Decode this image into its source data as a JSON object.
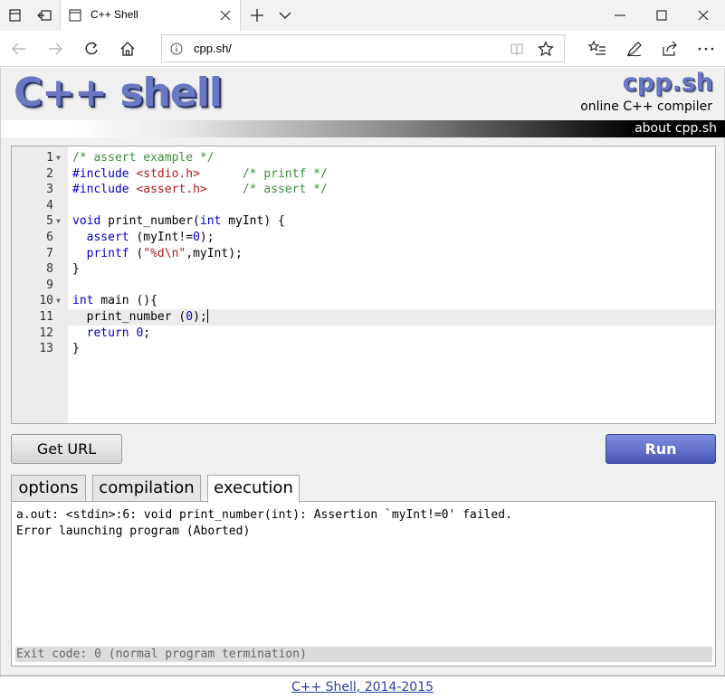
{
  "browser": {
    "tab_title": "C++ Shell",
    "address": "cpp.sh/"
  },
  "header": {
    "logo_big": "C++ shell",
    "logo_small": "cpp.sh",
    "tagline": "online C++ compiler",
    "about_link": "about cpp.sh"
  },
  "editor": {
    "lines": [
      {
        "n": "1",
        "fold": true
      },
      {
        "n": "2",
        "fold": false
      },
      {
        "n": "3",
        "fold": false
      },
      {
        "n": "4",
        "fold": false
      },
      {
        "n": "5",
        "fold": true
      },
      {
        "n": "6",
        "fold": false
      },
      {
        "n": "7",
        "fold": false
      },
      {
        "n": "8",
        "fold": false
      },
      {
        "n": "9",
        "fold": false
      },
      {
        "n": "10",
        "fold": true
      },
      {
        "n": "11",
        "fold": false
      },
      {
        "n": "12",
        "fold": false
      },
      {
        "n": "13",
        "fold": false
      }
    ],
    "code": [
      [
        {
          "t": "/* assert example */",
          "c": "com"
        }
      ],
      [
        {
          "t": "#include ",
          "c": "pp"
        },
        {
          "t": "<stdio.h>",
          "c": "str"
        },
        {
          "t": "      ",
          "c": ""
        },
        {
          "t": "/* printf */",
          "c": "com"
        }
      ],
      [
        {
          "t": "#include ",
          "c": "pp"
        },
        {
          "t": "<assert.h>",
          "c": "str"
        },
        {
          "t": "     ",
          "c": ""
        },
        {
          "t": "/* assert */",
          "c": "com"
        }
      ],
      [],
      [
        {
          "t": "void",
          "c": "kw"
        },
        {
          "t": " print_number(",
          "c": ""
        },
        {
          "t": "int",
          "c": "kw"
        },
        {
          "t": " myInt) {",
          "c": ""
        }
      ],
      [
        {
          "t": "  assert",
          "c": "kw"
        },
        {
          "t": " (myInt!=",
          "c": ""
        },
        {
          "t": "0",
          "c": "num"
        },
        {
          "t": ");",
          "c": ""
        }
      ],
      [
        {
          "t": "  printf",
          "c": "kw"
        },
        {
          "t": " (",
          "c": ""
        },
        {
          "t": "\"%d\\n\"",
          "c": "str"
        },
        {
          "t": ",myInt);",
          "c": ""
        }
      ],
      [
        {
          "t": "}",
          "c": ""
        }
      ],
      [],
      [
        {
          "t": "int",
          "c": "kw"
        },
        {
          "t": " main (){",
          "c": ""
        }
      ],
      [
        {
          "t": "  print_number (",
          "c": ""
        },
        {
          "t": "0",
          "c": "num"
        },
        {
          "t": ");",
          "c": ""
        }
      ],
      [
        {
          "t": "  return",
          "c": "kw"
        },
        {
          "t": " ",
          "c": ""
        },
        {
          "t": "0",
          "c": "num"
        },
        {
          "t": ";",
          "c": ""
        }
      ],
      [
        {
          "t": "}",
          "c": ""
        }
      ]
    ],
    "active_line": 11
  },
  "buttons": {
    "get_url": "Get URL",
    "run": "Run"
  },
  "tabs": [
    "options",
    "compilation",
    "execution"
  ],
  "active_tab": "execution",
  "output": {
    "lines": [
      "a.out: <stdin>:6: void print_number(int): Assertion `myInt!=0' failed.",
      "Error launching program (Aborted)"
    ],
    "exit": "Exit code: 0 (normal program termination)"
  },
  "footer": {
    "link": "C++ Shell, 2014-2015"
  },
  "colors": {
    "logo": "#6a78c2",
    "run_button": "#4a58b5",
    "comment": "#3d8f3d",
    "keyword": "#0000cc",
    "string": "#b31b1b"
  }
}
